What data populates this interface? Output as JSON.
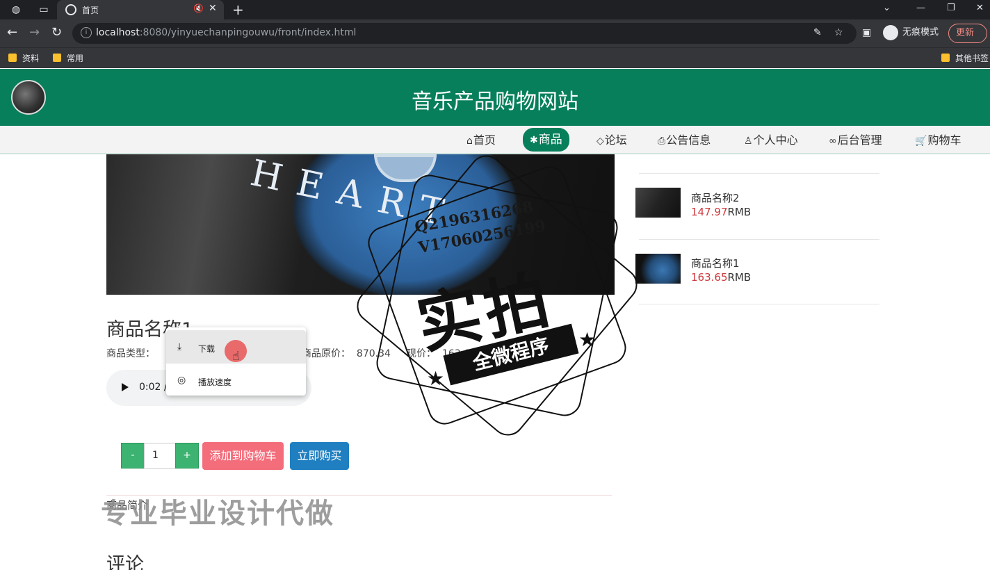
{
  "browser": {
    "tab_title": "首页",
    "url_host": "localhost",
    "url_rest": ":8080/yinyuechanpingouwu/front/index.html",
    "incognito_label": "无痕模式",
    "update_label": "更新",
    "bookmarks": [
      "资料",
      "常用"
    ],
    "other_bookmarks": "其他书签"
  },
  "site": {
    "title": "音乐产品购物网站",
    "nav": [
      {
        "label": "首页",
        "icon": "⌂"
      },
      {
        "label": "商品",
        "icon": "✱"
      },
      {
        "label": "论坛",
        "icon": "◇"
      },
      {
        "label": "公告信息",
        "icon": "⎙"
      },
      {
        "label": "个人中心",
        "icon": "♙"
      },
      {
        "label": "后台管理",
        "icon": "∞"
      },
      {
        "label": "购物车",
        "icon": "🛒"
      }
    ]
  },
  "product": {
    "cd_text": "HEART",
    "name": "商品名称1",
    "type_label": "商品类型：",
    "orig_price_label": "商品原价：",
    "orig_price": "870.34",
    "now_price_label": "现价：",
    "now_price": "163.65",
    "audio_time": "0:02 /",
    "quantity": "1",
    "minus": "-",
    "plus": "+",
    "add_to_cart": "添加到购物车",
    "buy_now": "立即购买",
    "intro_label": "商品简介",
    "comments_title": "评论"
  },
  "context_menu": {
    "download": "下载",
    "speed": "播放速度"
  },
  "sidebar": {
    "items": [
      {
        "name": "商品名称2",
        "price": "147.97",
        "unit": "RMB"
      },
      {
        "name": "商品名称1",
        "price": "163.65",
        "unit": "RMB"
      }
    ]
  },
  "watermark": {
    "qq": "Q2196316268",
    "v": "V17060256199",
    "big": "实拍",
    "ribbon": "全微程序",
    "bottom": "专业毕业设计代做"
  }
}
